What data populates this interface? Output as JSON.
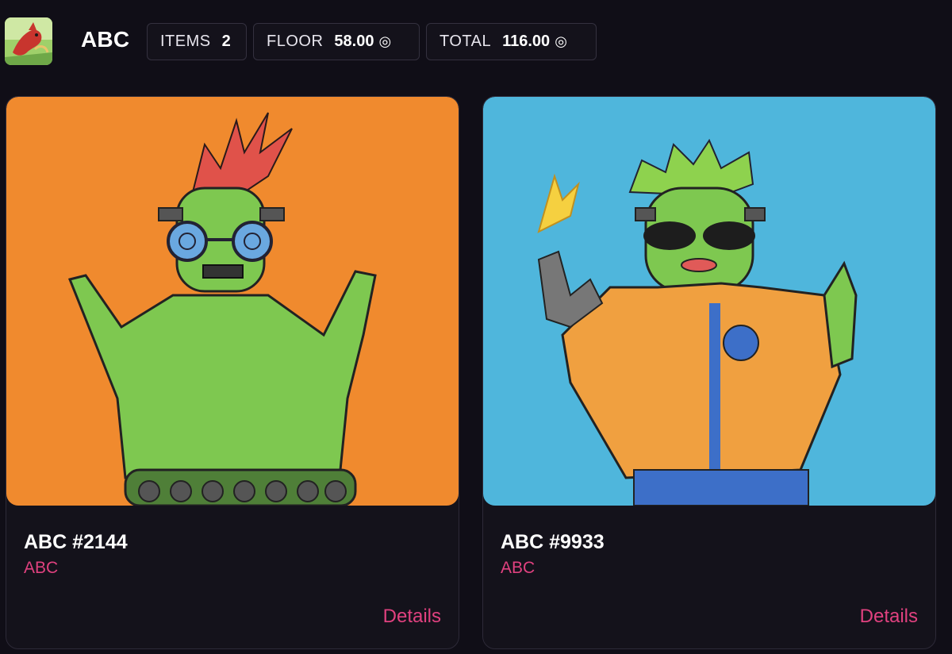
{
  "header": {
    "collection_name": "ABC",
    "stats": [
      {
        "label": "ITEMS",
        "value": "2",
        "unit": ""
      },
      {
        "label": "FLOOR",
        "value": "58.00",
        "unit": "◎"
      },
      {
        "label": "TOTAL",
        "value": "116.00",
        "unit": "◎"
      }
    ]
  },
  "cards": [
    {
      "title": "ABC #2144",
      "collection": "ABC",
      "details_label": "Details",
      "background_color": "#f08a2e"
    },
    {
      "title": "ABC #9933",
      "collection": "ABC",
      "details_label": "Details",
      "background_color": "#4fb6dc"
    }
  ],
  "colors": {
    "accent": "#e0417f",
    "background": "#100e17",
    "card": "#14121b"
  }
}
